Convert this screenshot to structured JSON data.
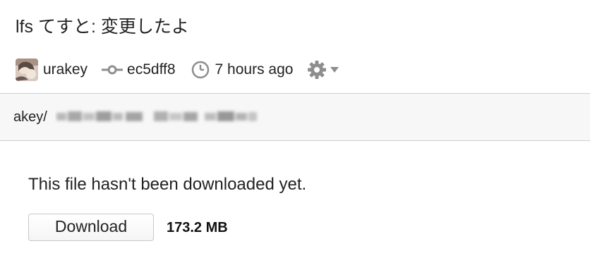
{
  "commit": {
    "title": "lfs てすと: 変更したよ",
    "author": "urakey",
    "sha": "ec5dff8",
    "time": "7 hours ago"
  },
  "icons": {
    "commit": "git-commit-icon",
    "clock": "clock-icon",
    "settings": "gear-icon",
    "dropdown": "caret-down-icon",
    "avatar": "user-avatar"
  },
  "path": {
    "prefix": "akey/"
  },
  "file": {
    "message": "This file hasn't been downloaded yet.",
    "download_label": "Download",
    "size": "173.2 MB"
  },
  "colors": {
    "icon_gray": "#8e8e8e",
    "path_bar_bg": "#f7f7f7",
    "border": "#cfcfcf"
  }
}
